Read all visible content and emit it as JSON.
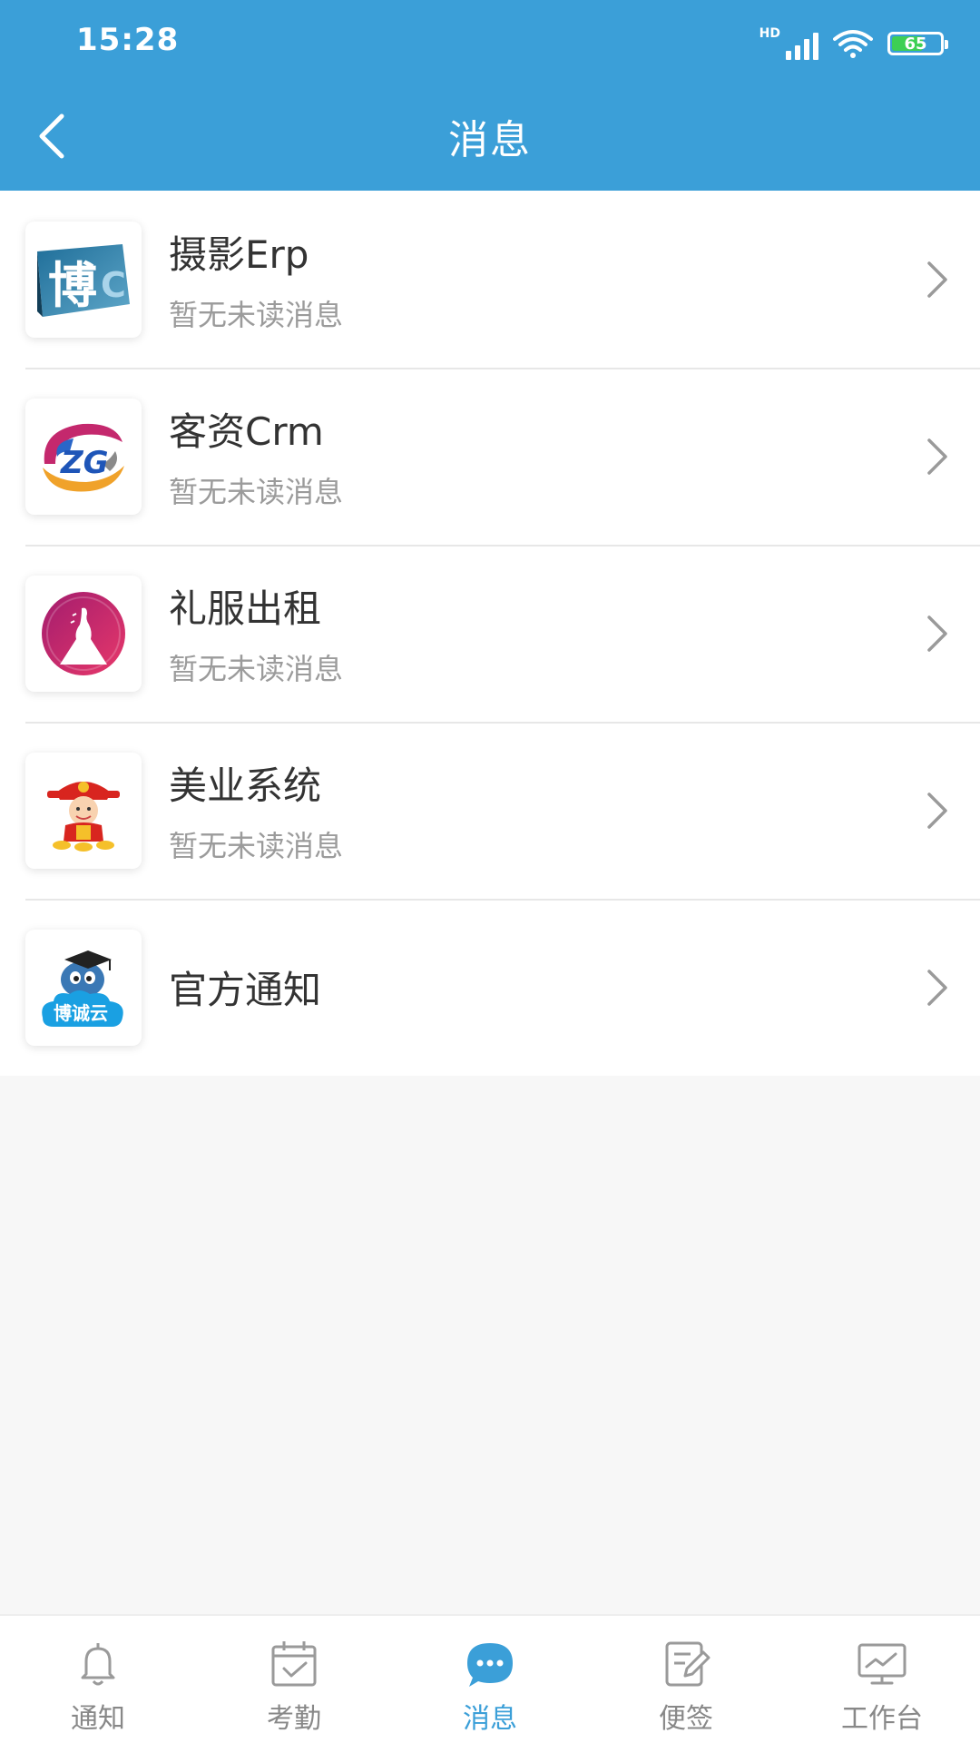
{
  "status_bar": {
    "time": "15:28",
    "network_label": "HD",
    "battery_level": "65",
    "battery_percent": 65
  },
  "header": {
    "title": "消息"
  },
  "list": [
    {
      "title": "摄影Erp",
      "subtitle": "暂无未读消息",
      "icon": "bocheng-erp-logo",
      "icon_text": "博"
    },
    {
      "title": "客资Crm",
      "subtitle": "暂无未读消息",
      "icon": "zg-crm-logo",
      "icon_text": "ZG"
    },
    {
      "title": "礼服出租",
      "subtitle": "暂无未读消息",
      "icon": "dress-rental-logo"
    },
    {
      "title": "美业系统",
      "subtitle": "暂无未读消息",
      "icon": "god-of-wealth-logo"
    },
    {
      "title": "官方通知",
      "subtitle": "",
      "icon": "bocheng-cloud-logo",
      "icon_text": "博诚云"
    }
  ],
  "bottom_nav": {
    "items": [
      {
        "label": "通知",
        "icon": "bell-icon",
        "active": false
      },
      {
        "label": "考勤",
        "icon": "calendar-check-icon",
        "active": false
      },
      {
        "label": "消息",
        "icon": "chat-bubble-icon",
        "active": true
      },
      {
        "label": "便签",
        "icon": "note-edit-icon",
        "active": false
      },
      {
        "label": "工作台",
        "icon": "monitor-chart-icon",
        "active": false
      }
    ]
  },
  "colors": {
    "primary": "#3b9fd8",
    "text_primary": "#333333",
    "text_secondary": "#9b9b9b",
    "battery_green": "#3dcf54"
  }
}
